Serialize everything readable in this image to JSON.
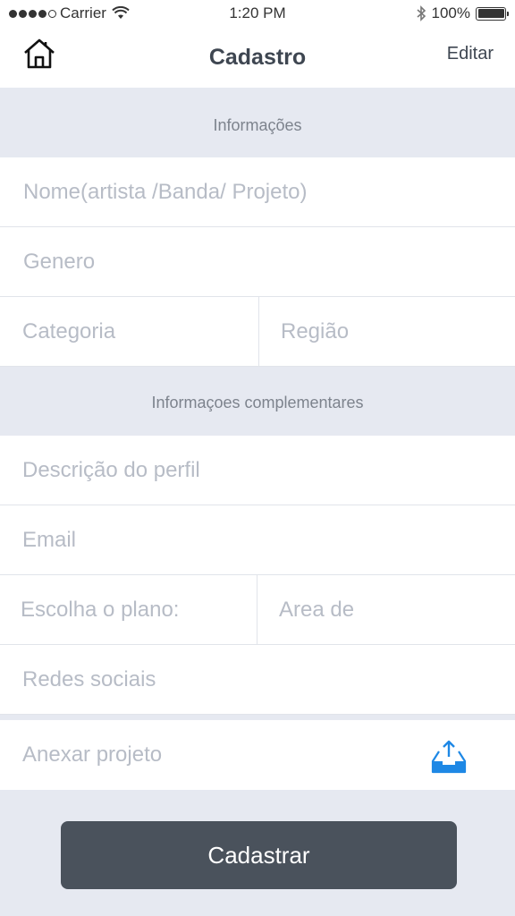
{
  "status_bar": {
    "carrier": "Carrier",
    "time": "1:20 PM",
    "battery": "100%",
    "battery_level": 1.0
  },
  "nav": {
    "title": "Cadastro",
    "edit_label": "Editar",
    "home_icon": "home-icon"
  },
  "sections": {
    "info_title": "Informações",
    "extra_title": "Informaçoes complementares"
  },
  "fields": {
    "name_placeholder": "Nome(artista /Banda/ Projeto)",
    "genre_placeholder": "Genero",
    "category_placeholder": "Categoria",
    "region_placeholder": "Região",
    "description_placeholder": "Descrição do perfil",
    "email_placeholder": "Email",
    "plan_placeholder": "Escolha o plano:",
    "area_placeholder": "Area de",
    "social_placeholder": "Redes sociais",
    "attach_placeholder": "Anexar projeto"
  },
  "actions": {
    "submit_label": "Cadastrar",
    "upload_icon": "upload-icon"
  },
  "colors": {
    "accent": "#1e88e5",
    "button_bg": "#4a525c",
    "background": "#e6e9f1",
    "placeholder": "#b7bcc6"
  }
}
